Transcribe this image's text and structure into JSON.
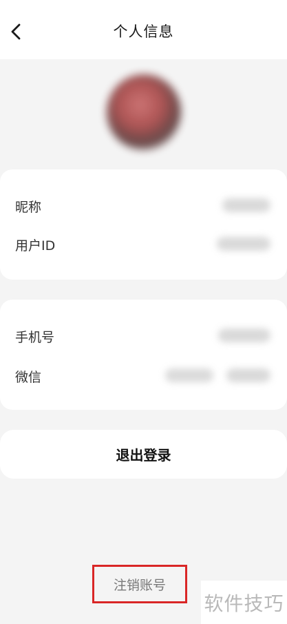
{
  "header": {
    "title": "个人信息",
    "back_icon": "chevron-left-icon"
  },
  "profile": {
    "avatar": "avatar-image-blurred"
  },
  "account_info": {
    "rows": [
      {
        "label": "昵称"
      },
      {
        "label": "用户ID"
      }
    ]
  },
  "binding_info": {
    "rows": [
      {
        "label": "手机号"
      },
      {
        "label": "微信"
      }
    ]
  },
  "actions": {
    "logout_label": "退出登录",
    "cancel_account_label": "注销账号"
  },
  "watermark": {
    "text": "软件技巧"
  },
  "colors": {
    "background": "#f4f4f4",
    "card": "#ffffff",
    "highlight_box": "#d92626",
    "muted_text": "#777777"
  }
}
